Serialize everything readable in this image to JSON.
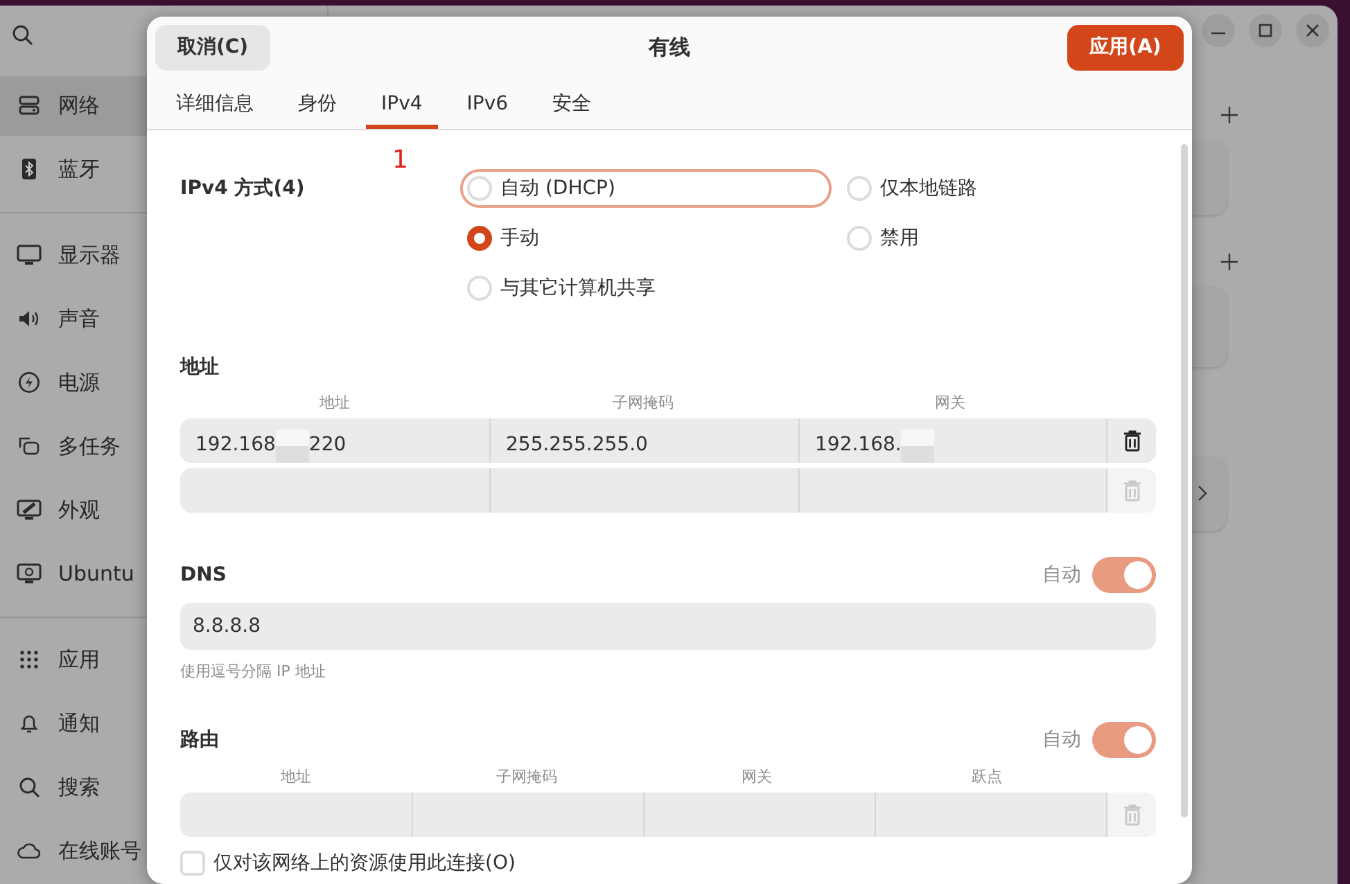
{
  "sidebar": {
    "groups": [
      [
        {
          "label": "网络",
          "selected": true
        },
        {
          "label": "蓝牙",
          "selected": false
        }
      ],
      [
        {
          "label": "显示器",
          "selected": false
        },
        {
          "label": "声音",
          "selected": false
        },
        {
          "label": "电源",
          "selected": false
        },
        {
          "label": "多任务",
          "selected": false
        },
        {
          "label": "外观",
          "selected": false
        },
        {
          "label": "Ubuntu",
          "selected": false
        }
      ],
      [
        {
          "label": "应用",
          "selected": false
        },
        {
          "label": "通知",
          "selected": false
        },
        {
          "label": "搜索",
          "selected": false
        },
        {
          "label": "在线账号",
          "selected": false
        }
      ]
    ]
  },
  "dialog": {
    "title": "有线",
    "cancel": "取消(C)",
    "apply": "应用(A)",
    "tabs": [
      {
        "label": "详细信息",
        "selected": false
      },
      {
        "label": "身份",
        "selected": false
      },
      {
        "label": "IPv4",
        "selected": true
      },
      {
        "label": "IPv6",
        "selected": false
      },
      {
        "label": "安全",
        "selected": false
      }
    ],
    "annotation": "1",
    "ipv4_method": {
      "label": "IPv4 方式(4)",
      "options": [
        {
          "label": "自动 (DHCP)",
          "selected": false,
          "focused": true
        },
        {
          "label": "仅本地链路",
          "selected": false,
          "focused": false
        },
        {
          "label": "手动",
          "selected": true,
          "focused": false
        },
        {
          "label": "禁用",
          "selected": false,
          "focused": false
        },
        {
          "label": "与其它计算机共享",
          "selected": false,
          "focused": false
        }
      ]
    },
    "addresses": {
      "title": "地址",
      "columns": [
        "地址",
        "子网掩码",
        "网关"
      ],
      "rows": [
        {
          "cells": [
            {
              "text": "192.168",
              "redacted": true,
              "text_after": "220"
            },
            {
              "text": "255.255.255.0",
              "redacted": false
            },
            {
              "text": "192.168.",
              "redacted": true
            }
          ],
          "deletable": true
        },
        {
          "cells": [
            {},
            {},
            {}
          ],
          "deletable": false
        }
      ]
    },
    "dns": {
      "title": "DNS",
      "auto_label": "自动",
      "auto_on": true,
      "value": "8.8.8.8",
      "hint": "使用逗号分隔 IP 地址"
    },
    "routes": {
      "title": "路由",
      "auto_label": "自动",
      "auto_on": true,
      "columns": [
        "地址",
        "子网掩码",
        "网关",
        "跃点"
      ],
      "rows": [
        {
          "cells": [
            {},
            {},
            {},
            {}
          ],
          "deletable": false
        }
      ]
    },
    "only_local": {
      "label": "仅对该网络上的资源使用此连接(O)",
      "checked": false
    }
  }
}
